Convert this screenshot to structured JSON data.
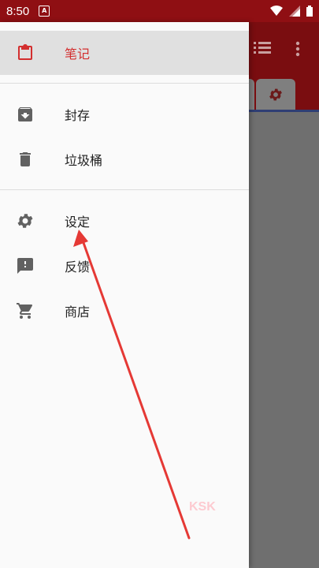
{
  "status_bar": {
    "time": "8:50",
    "app_icon_letter": "A"
  },
  "drawer": {
    "items": [
      {
        "label": "笔记",
        "icon": "clipboard-icon",
        "selected": true
      },
      {
        "label": "封存",
        "icon": "archive-icon"
      },
      {
        "label": "垃圾桶",
        "icon": "trash-icon"
      },
      {
        "label": "设定",
        "icon": "gear-icon"
      },
      {
        "label": "反馈",
        "icon": "feedback-icon"
      },
      {
        "label": "商店",
        "icon": "cart-icon"
      }
    ]
  },
  "watermark": "KSK",
  "colors": {
    "status_bar": "#8f0f13",
    "accent": "#d32f2f",
    "annotation_arrow": "#e53935"
  }
}
